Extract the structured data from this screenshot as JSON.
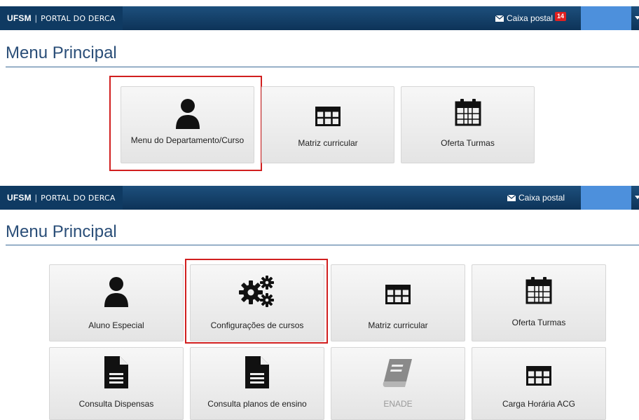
{
  "screenshot_top": {
    "navbar": {
      "brand_strong": "UFSM",
      "brand_sep": "|",
      "brand_text": "PORTAL DO DERCA",
      "mail_label": "Caixa postal",
      "mail_badge": "14"
    },
    "title": "Menu Principal",
    "tiles": [
      {
        "label": "Menu do Departamento/Curso",
        "icon": "user-icon",
        "highlighted": true
      },
      {
        "label": "Matriz curricular",
        "icon": "table-grid-icon"
      },
      {
        "label": "Oferta Turmas",
        "icon": "calendar-icon"
      }
    ]
  },
  "screenshot_bottom": {
    "navbar": {
      "brand_strong": "UFSM",
      "brand_sep": "|",
      "brand_text": "PORTAL DO DERCA",
      "mail_label": "Caixa postal"
    },
    "title": "Menu Principal",
    "tiles_row1": [
      {
        "label": "Aluno Especial",
        "icon": "user-icon"
      },
      {
        "label": "Configurações de cursos",
        "icon": "gears-icon",
        "highlighted": true
      },
      {
        "label": "Matriz curricular",
        "icon": "table-grid-icon"
      },
      {
        "label": "Oferta Turmas",
        "icon": "calendar-icon"
      }
    ],
    "tiles_row2": [
      {
        "label": "Consulta Dispensas",
        "icon": "document-icon"
      },
      {
        "label": "Consulta planos de ensino",
        "icon": "document-icon"
      },
      {
        "label": "ENADE",
        "icon": "book-icon",
        "disabled": true
      },
      {
        "label": "Carga Horária ACG",
        "icon": "table-grid-icon"
      }
    ]
  },
  "colors": {
    "navbar": "#0d3358",
    "user_box": "#4d90dc",
    "title": "#2a4e78",
    "highlight": "#d11f1f",
    "badge": "#e02020"
  }
}
